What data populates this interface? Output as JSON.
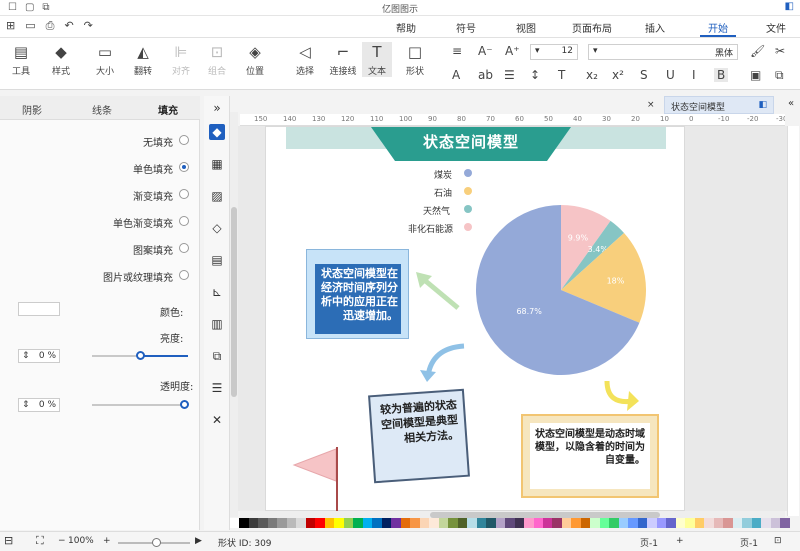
{
  "window": {
    "title": "亿图图示"
  },
  "menu": {
    "items": [
      "文件",
      "开始",
      "插入",
      "页面布局",
      "视图",
      "符号",
      "帮助"
    ],
    "active": "开始"
  },
  "toolbar": {
    "font_name": "黑体",
    "font_size": "12",
    "groups": [
      {
        "icon": "cursor-icon",
        "label": "选择"
      },
      {
        "icon": "text-T-icon",
        "label": "文本"
      },
      {
        "icon": "shape-square-icon",
        "label": "形状"
      },
      {
        "icon": "connector-icon",
        "label": "连接线"
      },
      {
        "icon": "layers-icon",
        "label": "位置"
      },
      {
        "icon": "group-icon",
        "label": "组合"
      },
      {
        "icon": "align-icon",
        "label": "对齐"
      },
      {
        "icon": "flip-icon",
        "label": "翻转"
      },
      {
        "icon": "size-icon",
        "label": "大小"
      },
      {
        "icon": "style-icon",
        "label": "样式"
      },
      {
        "icon": "tools-icon",
        "label": "工具"
      }
    ]
  },
  "left_panel": {
    "tabs": [
      "填充",
      "线条",
      "阴影"
    ],
    "active_tab": "填充",
    "fill_options": [
      "无填充",
      "单色填充",
      "渐变填充",
      "单色渐变填充",
      "图案填充",
      "图片或纹理填充"
    ],
    "selected_fill": "单色填充",
    "color_label": "颜色:",
    "brightness_label": "亮度:",
    "brightness_value": "0 %",
    "transparency_label": "透明度:",
    "transparency_value": "0 %"
  },
  "document": {
    "tab_name": "状态空间模型",
    "ruler_labels": [
      "150",
      "140",
      "130",
      "120",
      "110",
      "100",
      "90",
      "80",
      "70",
      "60",
      "50",
      "40",
      "30",
      "20",
      "10",
      "0",
      "-10",
      "-20",
      "-30"
    ]
  },
  "diagram": {
    "title": "状态空间模型",
    "legend": [
      {
        "label": "煤炭",
        "color": "#94a9d8"
      },
      {
        "label": "石油",
        "color": "#f8cf7c"
      },
      {
        "label": "天然气",
        "color": "#86c5c4"
      },
      {
        "label": "非化石能源",
        "color": "#f6c4c6"
      }
    ],
    "card1_text": "状态空间模型在经济时间序列分析中的应用正在迅速增加。",
    "card2_text": "较为普遍的状态空间模型是典型相关方法。",
    "card3_text": "状态空间模型是动态时域模型，以隐含着的时间为自变量。"
  },
  "chart_data": {
    "type": "pie",
    "categories": [
      "煤炭",
      "石油",
      "天然气",
      "非化石能源"
    ],
    "values": [
      68.7,
      18,
      3.4,
      9.9
    ],
    "data_labels": [
      "68.7%",
      "18%",
      "3.4%",
      "9.9%"
    ],
    "colors": [
      "#94a9d8",
      "#f8cf7c",
      "#86c5c4",
      "#f6c4c6"
    ],
    "title": ""
  },
  "status": {
    "shape_id": "形状 ID: 309",
    "zoom": "100%",
    "page_left": "页-1",
    "page_right": "页-1"
  },
  "palette": [
    "#ffffff",
    "#000000",
    "#3c3c3c",
    "#5a5a5a",
    "#7a7a7a",
    "#9a9a9a",
    "#bababa",
    "#dadada",
    "#c00000",
    "#ff0000",
    "#ffc000",
    "#ffff00",
    "#92d050",
    "#00b050",
    "#00b0f0",
    "#0070c0",
    "#002060",
    "#7030a0",
    "#e46c0a",
    "#f79646",
    "#fbd5b5",
    "#fde9d9",
    "#c3d69b",
    "#76923c",
    "#4f6228",
    "#b7dee8",
    "#31859b",
    "#205867",
    "#b3a2c7",
    "#5f497a",
    "#3f3151",
    "#ff99cc",
    "#ff66cc",
    "#cc3399",
    "#993366",
    "#ffcc99",
    "#ff9933",
    "#cc6600",
    "#ccffcc",
    "#66ff99",
    "#33cc66",
    "#99ccff",
    "#6699ff",
    "#3366cc",
    "#ccccff",
    "#9999ff",
    "#6666cc",
    "#ffffcc",
    "#ffff99",
    "#ffcc66",
    "#f2dcdb",
    "#e6b9b8",
    "#d99694",
    "#dbeef3",
    "#92cddc",
    "#4bacc6",
    "#e5e0ec",
    "#ccc1d9",
    "#8064a2"
  ]
}
